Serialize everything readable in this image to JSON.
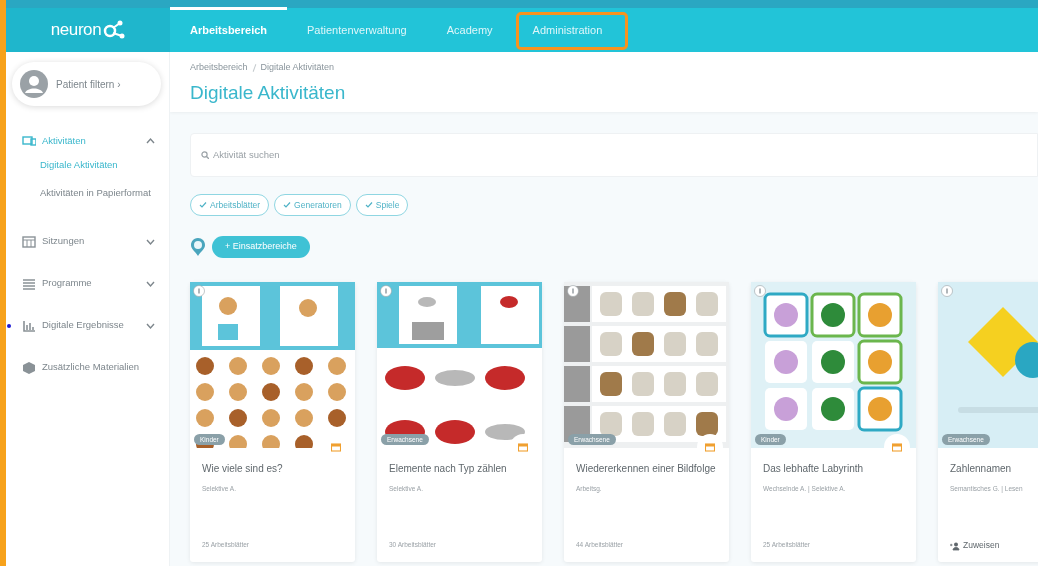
{
  "logo": {
    "text": "neuron"
  },
  "nav": {
    "tabs": [
      {
        "label": "Arbeitsbereich",
        "selected": true,
        "highlighted": false
      },
      {
        "label": "Patientenverwaltung",
        "selected": false,
        "highlighted": false
      },
      {
        "label": "Academy",
        "selected": false,
        "highlighted": false
      },
      {
        "label": "Administration",
        "selected": false,
        "highlighted": true
      }
    ]
  },
  "sidebar": {
    "patient_filter": {
      "label": "Patient filtern",
      "chevron": "›"
    },
    "items": [
      {
        "label": "Aktivitäten",
        "kind": "activities",
        "expanded": true,
        "selected": true,
        "dot": false,
        "children": [
          {
            "label": "Digitale Aktivitäten",
            "selected": true
          },
          {
            "label": "Aktivitäten in Papierformat",
            "selected": false
          }
        ]
      },
      {
        "label": "Sitzungen",
        "kind": "calendar",
        "expanded": false,
        "selected": false,
        "dot": false
      },
      {
        "label": "Programme",
        "kind": "list",
        "expanded": false,
        "selected": false,
        "dot": false
      },
      {
        "label": "Digitale Ergebnisse",
        "kind": "chart",
        "expanded": false,
        "selected": false,
        "dot": true
      },
      {
        "label": "Zusätzliche Materialien",
        "kind": "box",
        "selected": false,
        "dot": false
      }
    ]
  },
  "breadcrumb": [
    "Arbeitsbereich",
    "Digitale Aktivitäten"
  ],
  "page_title": "Digitale Aktivitäten",
  "search": {
    "placeholder": "Aktivität suchen"
  },
  "filters": [
    {
      "label": "Arbeitsblätter",
      "checked": true
    },
    {
      "label": "Generatoren",
      "checked": true
    },
    {
      "label": "Spiele",
      "checked": true
    }
  ],
  "areas_button": "+ Einsatzbereiche",
  "cards": [
    {
      "badge": "Kinder",
      "title": "Wie viele sind es?",
      "subtitle": "Selektive A.",
      "footer": "25 Arbeitsblätter",
      "kind": "count"
    },
    {
      "badge": "Erwachsene",
      "title": "Elemente nach Typ zählen",
      "subtitle": "Selektive A.",
      "footer": "30 Arbeitsblätter",
      "kind": "count"
    },
    {
      "badge": "Erwachsene",
      "title": "Wiedererkennen einer Bildfolge",
      "subtitle": "Arbeitsg.",
      "footer": "44 Arbeitsblätter",
      "kind": "count"
    },
    {
      "badge": "Kinder",
      "title": "Das lebhafte Labyrinth",
      "subtitle": "Wechselnde A. | Selektive A.",
      "footer": "25 Arbeitsblätter",
      "kind": "count"
    },
    {
      "badge": "Erwachsene",
      "title": "Zahlennamen",
      "subtitle": "Semantisches G. | Lesen",
      "footer": "Zuweisen",
      "kind": "assign"
    }
  ]
}
